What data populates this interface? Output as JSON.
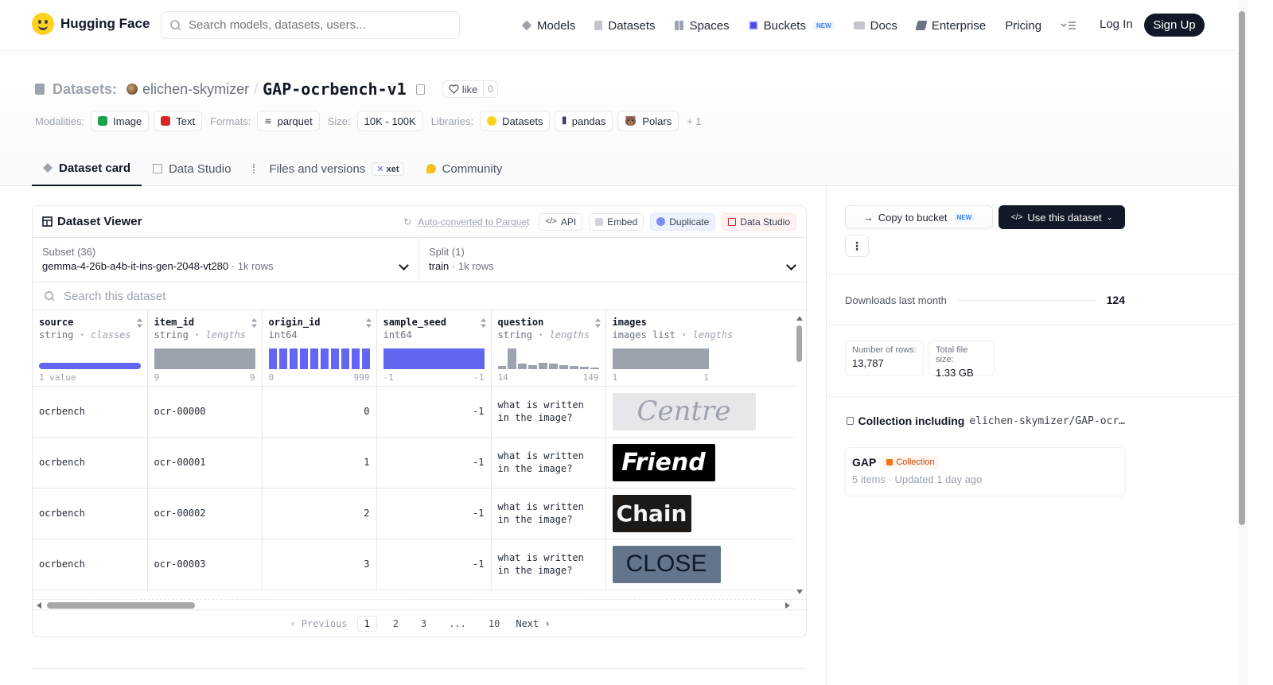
{
  "brand": {
    "name": "Hugging Face"
  },
  "search": {
    "placeholder": "Search models, datasets, users..."
  },
  "nav": {
    "items": [
      {
        "label": "Models",
        "icon": "cube-icon"
      },
      {
        "label": "Datasets",
        "icon": "database-icon"
      },
      {
        "label": "Spaces",
        "icon": "grid-icon"
      },
      {
        "label": "Buckets",
        "icon": "bucket-icon",
        "badge": "NEW"
      },
      {
        "label": "Docs",
        "icon": "book-icon"
      },
      {
        "label": "Enterprise",
        "icon": "enterprise-icon"
      },
      {
        "label": "Pricing"
      }
    ],
    "login": "Log In",
    "signup": "Sign Up"
  },
  "repo": {
    "type_label": "Datasets:",
    "owner": "elichen-skymizer",
    "slash": "/",
    "name": "GAP-ocrbench-v1",
    "like_label": "like",
    "like_count": "0"
  },
  "meta": {
    "modalities_label": "Modalities:",
    "modalities": [
      "Image",
      "Text"
    ],
    "formats_label": "Formats:",
    "formats": [
      "parquet"
    ],
    "size_label": "Size:",
    "size": "10K - 100K",
    "libraries_label": "Libraries:",
    "libraries": [
      "Datasets",
      "pandas",
      "Polars"
    ],
    "more": "+ 1"
  },
  "tabs": [
    {
      "label": "Dataset card",
      "active": true
    },
    {
      "label": "Data Studio"
    },
    {
      "label": "Files and versions",
      "badge": "xet"
    },
    {
      "label": "Community"
    }
  ],
  "viewer": {
    "title": "Dataset Viewer",
    "auto_converted": "Auto-converted to Parquet",
    "actions": [
      "API",
      "Embed",
      "Duplicate",
      "Data Studio"
    ],
    "subset_label": "Subset (36)",
    "subset_value": "gemma-4-26b-a4b-it-ins-gen-2048-vt280",
    "subset_rows": "1k rows",
    "split_label": "Split (1)",
    "split_value": "train",
    "split_rows": "1k rows",
    "search_placeholder": "Search this dataset",
    "columns": [
      {
        "name": "source",
        "type": "string",
        "stat": "classes",
        "range_min": "1 value",
        "range_max": ""
      },
      {
        "name": "item_id",
        "type": "string",
        "stat": "lengths",
        "range_min": "9",
        "range_max": "9"
      },
      {
        "name": "origin_id",
        "type": "int64",
        "stat": "",
        "range_min": "0",
        "range_max": "999"
      },
      {
        "name": "sample_seed",
        "type": "int64",
        "stat": "",
        "range_min": "-1",
        "range_max": "-1"
      },
      {
        "name": "question",
        "type": "string",
        "stat": "lengths",
        "range_min": "14",
        "range_max": "149"
      },
      {
        "name": "images",
        "type": "images list",
        "stat": "lengths",
        "range_min": "1",
        "range_max": "1"
      }
    ],
    "question_hist": [
      0.15,
      1.0,
      0.25,
      0.2,
      0.3,
      0.25,
      0.2,
      0.15,
      0.1,
      0.08
    ],
    "rows": [
      {
        "source": "ocrbench",
        "item_id": "ocr-00000",
        "origin_id": "0",
        "sample_seed": "-1",
        "question": "what is written in the image?",
        "image_text": "Centre"
      },
      {
        "source": "ocrbench",
        "item_id": "ocr-00001",
        "origin_id": "1",
        "sample_seed": "-1",
        "question": "what is written in the image?",
        "image_text": "Friend"
      },
      {
        "source": "ocrbench",
        "item_id": "ocr-00002",
        "origin_id": "2",
        "sample_seed": "-1",
        "question": "what is written in the image?",
        "image_text": "Chain"
      },
      {
        "source": "ocrbench",
        "item_id": "ocr-00003",
        "origin_id": "3",
        "sample_seed": "-1",
        "question": "what is written in the image?",
        "image_text": "CLOSE"
      }
    ],
    "pager": {
      "prev": "Previous",
      "pages": [
        "1",
        "2",
        "3",
        "...",
        "10"
      ],
      "next": "Next"
    }
  },
  "sidebar": {
    "copy_bucket": "Copy to bucket",
    "copy_badge": "NEW",
    "use_dataset": "Use this dataset",
    "more": "⋮",
    "downloads_label": "Downloads last month",
    "downloads_value": "124",
    "rows_label": "Number of rows:",
    "rows_value": "13,787",
    "size_label": "Total file size:",
    "size_value": "1.33 GB",
    "collection_prefix": "Collection including",
    "collection_repo": "elichen-skymizer/GAP-ocr…",
    "collection_name": "GAP",
    "collection_badge": "Collection",
    "collection_items": "5 items",
    "collection_dot": "·",
    "collection_updated": "Updated 1 day ago"
  },
  "colors": {
    "accent": "#6366f1",
    "hist_gray": "#9ca3af",
    "dark": "#111827"
  }
}
